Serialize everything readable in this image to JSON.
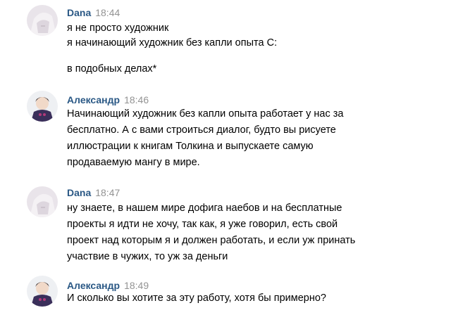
{
  "messages": [
    {
      "author": "Dana",
      "time": "18:44",
      "lines": [
        "я не просто художник",
        "я начинающий художник без капли опыта С:",
        "в подобных делах*"
      ]
    },
    {
      "author": "Александр",
      "time": "18:46",
      "lines": [
        "Начинающий художник без капли опыта работает у нас за",
        "бесплатно. А с вами строиться диалог, будто вы рисуете",
        "иллюстрации к книгам Толкина и выпускаете самую",
        "продаваемую мангу в мире."
      ]
    },
    {
      "author": "Dana",
      "time": "18:47",
      "lines": [
        "ну знаете, в нашем мире дофига наебов и на бесплатные",
        "проекты я идти не хочу, так как, я уже говорил, есть свой",
        "проект над которым я и должен работать, и если уж принать",
        "участвие в чужих, то уж за деньги"
      ]
    },
    {
      "author": "Александр",
      "time": "18:49",
      "lines": [
        "И сколько вы хотите за эту работу, хотя бы примерно?"
      ]
    }
  ]
}
